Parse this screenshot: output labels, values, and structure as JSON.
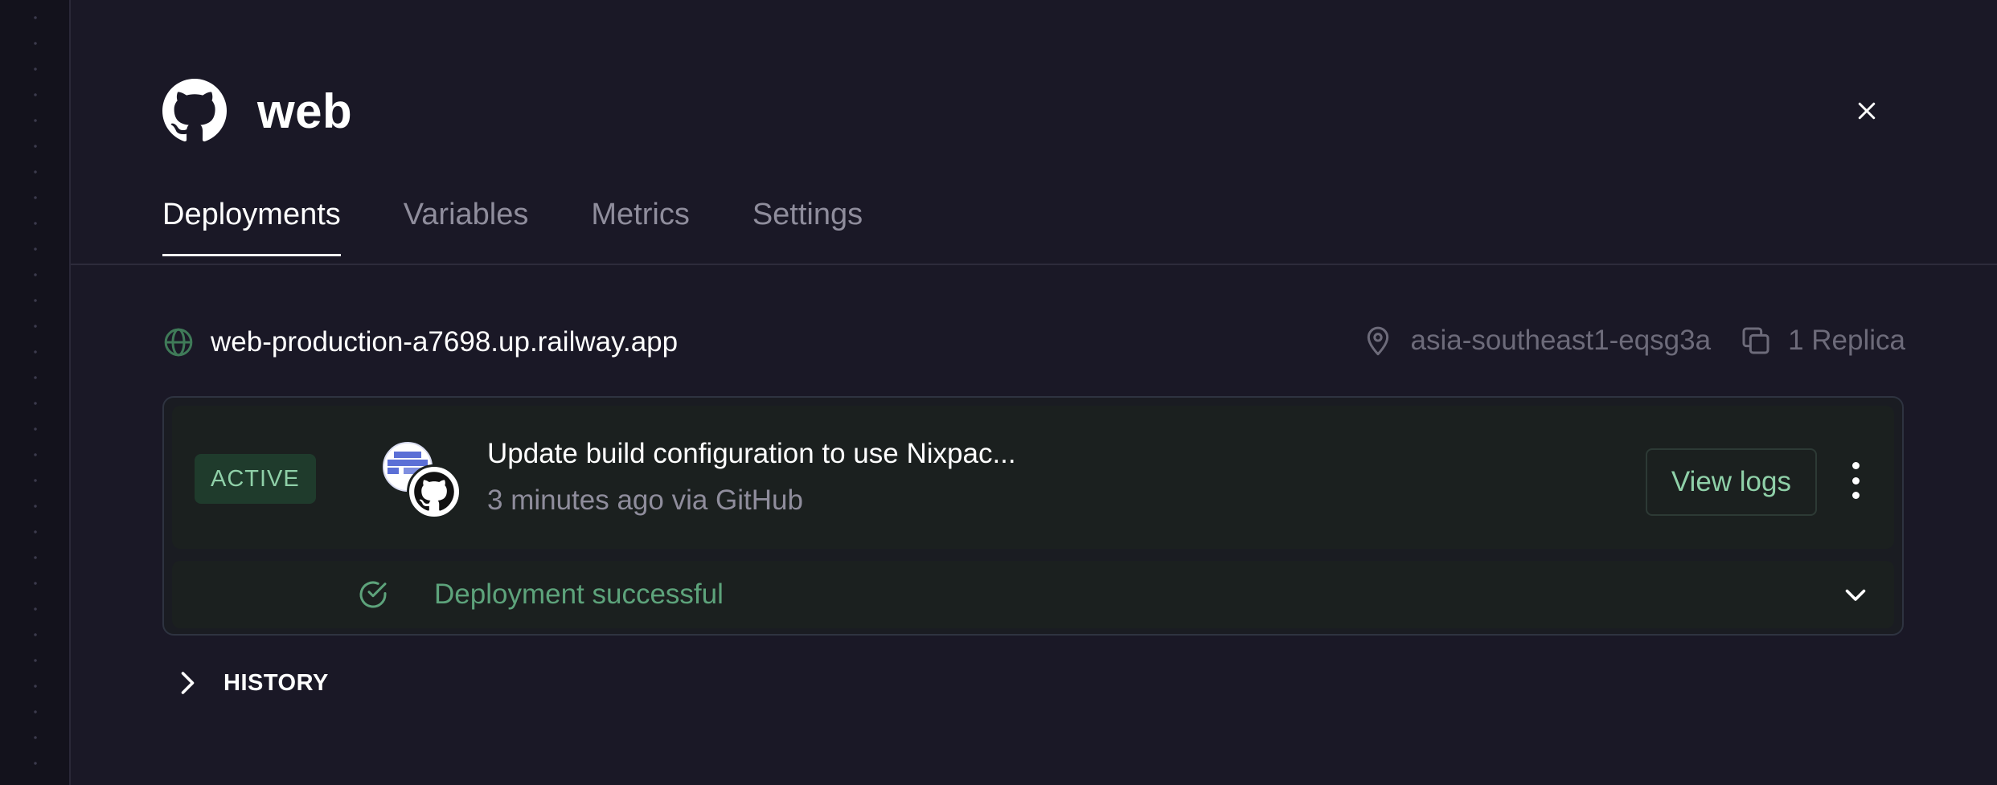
{
  "service": {
    "name": "web",
    "logo_icon": "github-icon"
  },
  "close_icon": "close-icon",
  "tabs": [
    {
      "label": "Deployments",
      "active": true
    },
    {
      "label": "Variables",
      "active": false
    },
    {
      "label": "Metrics",
      "active": false
    },
    {
      "label": "Settings",
      "active": false
    }
  ],
  "domain": {
    "url": "web-production-a7698.up.railway.app",
    "icon": "globe-icon"
  },
  "meta": {
    "region": "asia-southeast1-eqsg3a",
    "region_icon": "map-pin-icon",
    "replicas": "1 Replica",
    "replicas_icon": "copy-icon"
  },
  "deployment": {
    "status_badge": "ACTIVE",
    "commit_message": "Update build configuration to use Nixpac...",
    "commit_meta": "3 minutes ago via GitHub",
    "view_logs_label": "View logs",
    "result_text": "Deployment successful",
    "result_icon": "check-circle-icon"
  },
  "history": {
    "label": "HISTORY"
  },
  "colors": {
    "background": "#1a1826",
    "accent_green": "#8fd0a8",
    "success_green": "#5da37b",
    "muted_text": "#8f8d9c"
  }
}
